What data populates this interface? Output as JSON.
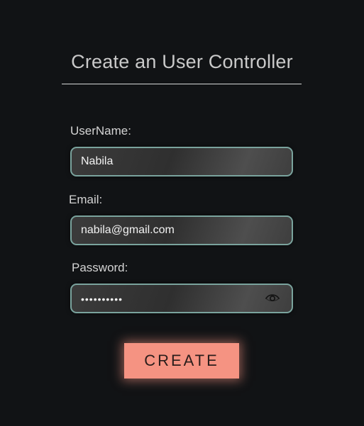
{
  "form": {
    "title": "Create an User Controller",
    "username": {
      "label": "UserName:",
      "value": "Nabila"
    },
    "email": {
      "label": "Email:",
      "value": "nabila@gmail.com"
    },
    "password": {
      "label": "Password:",
      "value": "••••••••••",
      "toggle_icon": "eye-icon"
    },
    "submit_label": "CREATE"
  },
  "colors": {
    "background": "#111315",
    "field_border": "#7aa39d",
    "button": "#f59382"
  }
}
